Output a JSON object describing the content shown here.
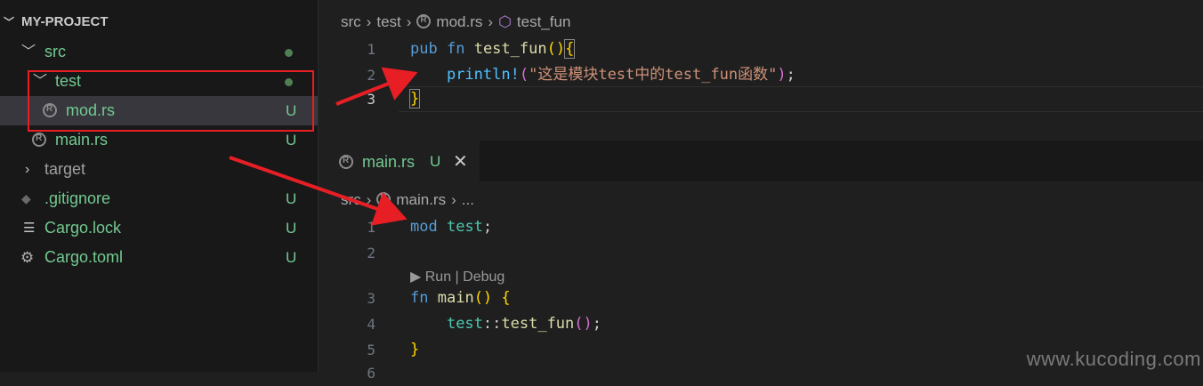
{
  "explorer": {
    "title": "MY-PROJECT",
    "items": [
      {
        "label": "src",
        "badge": "",
        "decoration": "dot"
      },
      {
        "label": "test",
        "badge": "",
        "decoration": "dot"
      },
      {
        "label": "mod.rs",
        "badge": "U"
      },
      {
        "label": "main.rs",
        "badge": "U"
      },
      {
        "label": "target",
        "badge": ""
      },
      {
        "label": ".gitignore",
        "badge": "U"
      },
      {
        "label": "Cargo.lock",
        "badge": "U"
      },
      {
        "label": "Cargo.toml",
        "badge": "U"
      }
    ]
  },
  "top_editor": {
    "breadcrumb": [
      "src",
      "test",
      "mod.rs",
      "test_fun"
    ],
    "lines": [
      {
        "num": "1",
        "t": [
          "pub",
          "fn",
          "test_fun",
          "()",
          "{"
        ]
      },
      {
        "num": "2",
        "t": [
          "println!",
          "(",
          "\"这是模块test中的test_fun函数\"",
          ")",
          ";"
        ]
      },
      {
        "num": "3",
        "t": [
          "}"
        ]
      }
    ]
  },
  "tab": {
    "label": "main.rs",
    "badge": "U",
    "close": "✕"
  },
  "bottom_editor": {
    "breadcrumb": [
      "src",
      "main.rs",
      "..."
    ],
    "codelens": "▶ Run | Debug",
    "lines": [
      {
        "num": "1",
        "t": [
          "mod",
          "test",
          ";"
        ]
      },
      {
        "num": "2",
        "t": []
      },
      {
        "num": "3",
        "t": [
          "fn",
          "main",
          "()",
          "{"
        ]
      },
      {
        "num": "4",
        "t": [
          "test",
          "::",
          "test_fun",
          "()",
          ";"
        ]
      },
      {
        "num": "5",
        "t": [
          "}"
        ]
      },
      {
        "num": "6",
        "t": []
      }
    ]
  },
  "watermark": "www.kucoding.com",
  "colors": {
    "accent_red": "#e81e25",
    "untracked_green": "#73c991",
    "keyword_blue": "#569cd6"
  }
}
